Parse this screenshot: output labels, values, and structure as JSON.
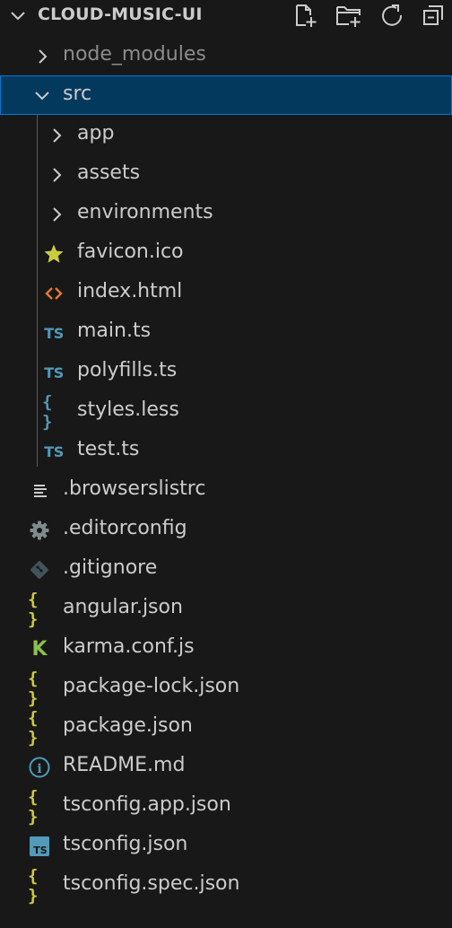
{
  "explorer": {
    "project_title": "CLOUD-MUSIC-UI",
    "actions": [
      "new-file-icon",
      "new-folder-icon",
      "refresh-icon",
      "collapse-all-icon"
    ]
  },
  "tree": [
    {
      "label": "node_modules",
      "kind": "folder",
      "state": "collapsed",
      "icon": "chevron-right-icon",
      "dim": true
    },
    {
      "label": "src",
      "kind": "folder",
      "state": "expanded",
      "icon": "chevron-down-icon",
      "selected": true
    },
    {
      "label": "app",
      "kind": "folder",
      "state": "collapsed",
      "icon": "chevron-right-icon"
    },
    {
      "label": "assets",
      "kind": "folder",
      "state": "collapsed",
      "icon": "chevron-right-icon"
    },
    {
      "label": "environments",
      "kind": "folder",
      "state": "collapsed",
      "icon": "chevron-right-icon"
    },
    {
      "label": "favicon.ico",
      "kind": "file",
      "icon": "star-icon",
      "color": "#cbcb41"
    },
    {
      "label": "index.html",
      "kind": "file",
      "icon": "html-code-icon",
      "color": "#e37933"
    },
    {
      "label": "main.ts",
      "kind": "file",
      "icon": "typescript-icon",
      "glyph": "TS",
      "color": "#519aba"
    },
    {
      "label": "polyfills.ts",
      "kind": "file",
      "icon": "typescript-icon",
      "glyph": "TS",
      "color": "#519aba"
    },
    {
      "label": "styles.less",
      "kind": "file",
      "icon": "braces-icon",
      "glyph": "{ }",
      "color": "#519aba"
    },
    {
      "label": "test.ts",
      "kind": "file",
      "icon": "typescript-icon",
      "glyph": "TS",
      "color": "#519aba"
    },
    {
      "label": ".browserslistrc",
      "kind": "file",
      "icon": "lines-icon",
      "color": "#cccccc"
    },
    {
      "label": ".editorconfig",
      "kind": "file",
      "icon": "gear-icon",
      "color": "#7f8c8d"
    },
    {
      "label": ".gitignore",
      "kind": "file",
      "icon": "git-icon",
      "color": "#41535b"
    },
    {
      "label": "angular.json",
      "kind": "file",
      "icon": "json-braces-icon",
      "glyph": "{ }",
      "color": "#cbcb41"
    },
    {
      "label": "karma.conf.js",
      "kind": "file",
      "icon": "karma-icon",
      "glyph": "K",
      "color": "#8dc149"
    },
    {
      "label": "package-lock.json",
      "kind": "file",
      "icon": "json-braces-icon",
      "glyph": "{ }",
      "color": "#cbcb41"
    },
    {
      "label": "package.json",
      "kind": "file",
      "icon": "json-braces-icon",
      "glyph": "{ }",
      "color": "#cbcb41"
    },
    {
      "label": "README.md",
      "kind": "file",
      "icon": "info-icon",
      "glyph": "i",
      "color": "#519aba"
    },
    {
      "label": "tsconfig.app.json",
      "kind": "file",
      "icon": "json-braces-icon",
      "glyph": "{ }",
      "color": "#cbcb41"
    },
    {
      "label": "tsconfig.json",
      "kind": "file",
      "icon": "tsconfig-icon",
      "glyph": "TS",
      "color": "#519aba"
    },
    {
      "label": "tsconfig.spec.json",
      "kind": "file",
      "icon": "json-braces-icon",
      "glyph": "{ }",
      "color": "#cbcb41"
    }
  ]
}
